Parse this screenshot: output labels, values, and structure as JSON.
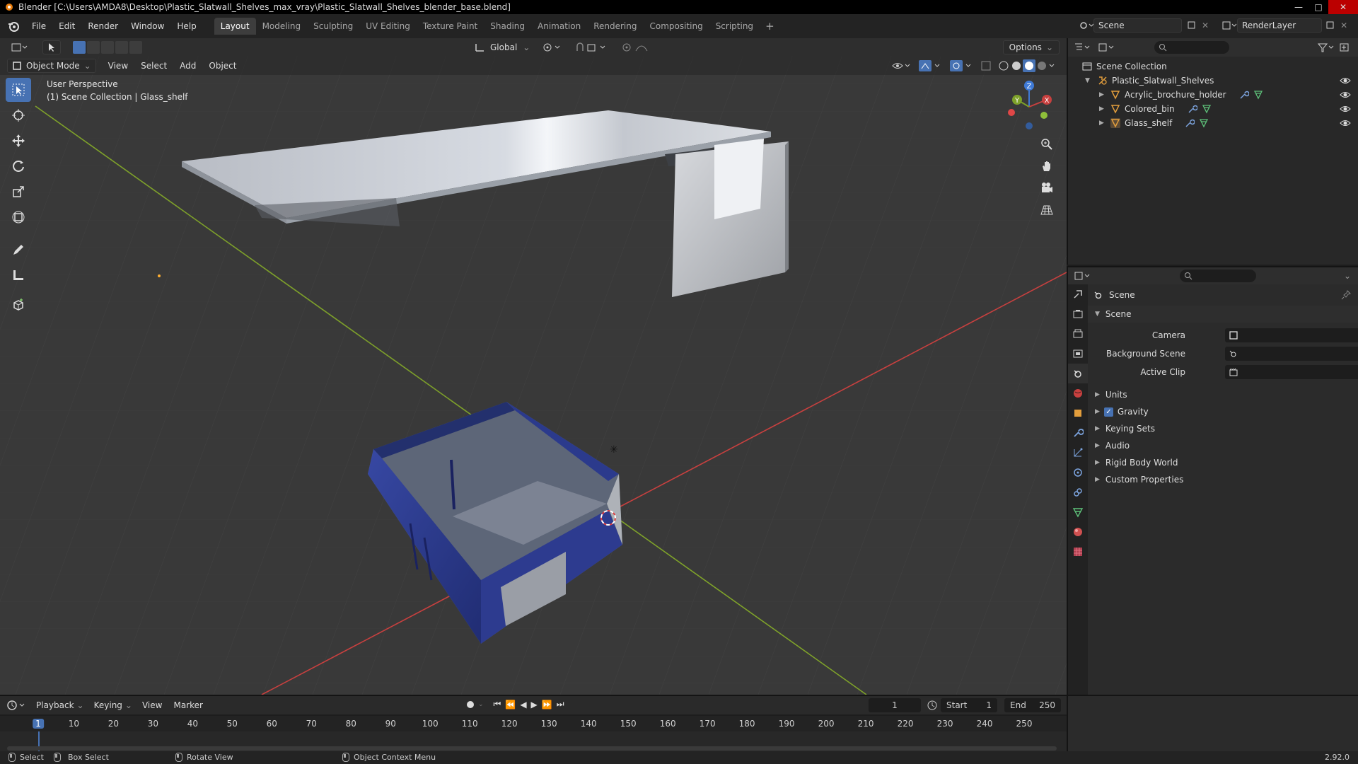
{
  "window": {
    "title": "Blender [C:\\Users\\AMDA8\\Desktop\\Plastic_Slatwall_Shelves_max_vray\\Plastic_Slatwall_Shelves_blender_base.blend]"
  },
  "menu": {
    "items": [
      "File",
      "Edit",
      "Render",
      "Window",
      "Help"
    ]
  },
  "workspaces": {
    "tabs": [
      "Layout",
      "Modeling",
      "Sculpting",
      "UV Editing",
      "Texture Paint",
      "Shading",
      "Animation",
      "Rendering",
      "Compositing",
      "Scripting"
    ],
    "active": "Layout",
    "add": "+"
  },
  "scene_selector": {
    "scene": "Scene",
    "view_layer": "RenderLayer"
  },
  "viewport_header": {
    "orientation": "Global",
    "options": "Options",
    "mode": "Object Mode",
    "menus": [
      "View",
      "Select",
      "Add",
      "Object"
    ]
  },
  "viewport_info": {
    "line1": "User Perspective",
    "line2": "(1) Scene Collection | Glass_shelf"
  },
  "gizmo": {
    "x": "X",
    "y": "Y",
    "z": "Z"
  },
  "outliner": {
    "root": "Scene Collection",
    "collection": "Plastic_Slatwall_Shelves",
    "objects": [
      "Acrylic_brochure_holder",
      "Colored_bin",
      "Glass_shelf"
    ]
  },
  "properties": {
    "context": "Scene",
    "panel": "Scene",
    "fields": [
      {
        "label": "Camera",
        "value": ""
      },
      {
        "label": "Background Scene",
        "value": ""
      },
      {
        "label": "Active Clip",
        "value": ""
      }
    ],
    "subpanels": [
      "Units",
      "Gravity",
      "Keying Sets",
      "Audio",
      "Rigid Body World",
      "Custom Properties"
    ],
    "gravity_checked": true
  },
  "timeline": {
    "menus": [
      "Playback",
      "Keying",
      "View",
      "Marker"
    ],
    "current_frame": "1",
    "start_label": "Start",
    "start": "1",
    "end_label": "End",
    "end": "250",
    "ruler": [
      "1",
      "10",
      "20",
      "30",
      "40",
      "50",
      "60",
      "70",
      "80",
      "90",
      "100",
      "110",
      "120",
      "130",
      "140",
      "150",
      "160",
      "170",
      "180",
      "190",
      "200",
      "210",
      "220",
      "230",
      "240",
      "250"
    ]
  },
  "statusbar": {
    "select": "Select",
    "box_select": "Box Select",
    "rotate_view": "Rotate View",
    "context_menu": "Object Context Menu",
    "version": "2.92.0"
  },
  "colors": {
    "accent": "#4772b3",
    "x_axis": "#c8403f",
    "y_axis": "#7ea12a",
    "z_axis": "#3f7ad6",
    "bin_blue": "#2b3a8c"
  }
}
